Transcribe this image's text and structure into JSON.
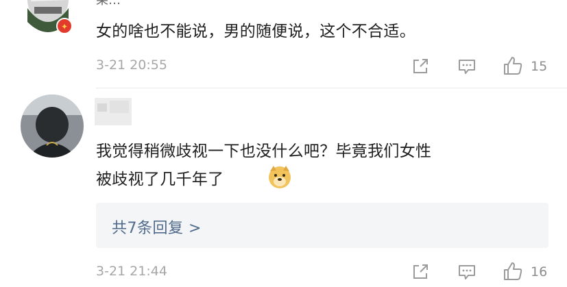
{
  "comments": [
    {
      "username": "果…",
      "text": "女的啥也不能说，男的随便说，这个不合适。",
      "time": "3-21 20:55",
      "likes": "15",
      "badge": "honor-badge"
    },
    {
      "username": "",
      "text_line1": "我觉得稍微歧视一下也没什么吧？毕竟我们女性",
      "text_line2": "被歧视了几千年了",
      "emoji": "doge-emoji",
      "replies_link": "共7条回复 >",
      "time": "3-21 21:44",
      "likes": "16"
    }
  ],
  "icons": {
    "share": "share-icon",
    "comment": "comment-icon",
    "like": "thumbs-up-icon"
  },
  "colors": {
    "text": "#1e1e1e",
    "meta": "#a6a6a6",
    "link": "#4f6a8c",
    "reply_bg": "#f4f5f7",
    "badge": "#e23b2e"
  }
}
